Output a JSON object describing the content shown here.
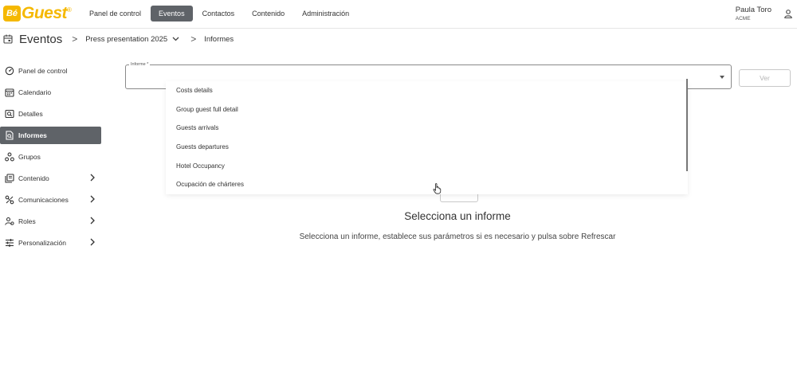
{
  "app": {
    "logo_be": "Bé",
    "logo_guest": "Guest",
    "logo_mark": "®"
  },
  "nav": {
    "items": [
      {
        "label": "Panel de control"
      },
      {
        "label": "Eventos",
        "active": true
      },
      {
        "label": "Contactos"
      },
      {
        "label": "Contenido"
      },
      {
        "label": "Administración"
      }
    ]
  },
  "user": {
    "name": "Paula Toro",
    "org": "ACME",
    "icon": "person-icon"
  },
  "breadcrumb": {
    "icon": "calendar-icon",
    "title": "Eventos",
    "separator": ">",
    "event": "Press presentation 2025",
    "event_chevron": "chevron-down-icon",
    "current": "Informes"
  },
  "sidebar": {
    "items": [
      {
        "label": "Panel de control",
        "icon": "dashboard-icon"
      },
      {
        "label": "Calendario",
        "icon": "calendar-icon"
      },
      {
        "label": "Detalles",
        "icon": "details-icon"
      },
      {
        "label": "Informes",
        "icon": "report-icon",
        "active": true
      },
      {
        "label": "Grupos",
        "icon": "groups-icon"
      },
      {
        "label": "Contenido",
        "icon": "content-icon",
        "expandable": true
      },
      {
        "label": "Comunicaciones",
        "icon": "communications-icon",
        "expandable": true
      },
      {
        "label": "Roles",
        "icon": "roles-icon",
        "expandable": true
      },
      {
        "label": "Personalización",
        "icon": "tune-icon",
        "expandable": true
      }
    ]
  },
  "report_select": {
    "label": "Informe *",
    "value": "",
    "options": [
      "Costs details",
      "Group guest full detail",
      "Guests arrivals",
      "Guests departures",
      "Hotel Occupancy",
      "Ocupación de chárteres"
    ]
  },
  "view_button": {
    "label": "Ver"
  },
  "empty_state": {
    "title": "Selecciona un informe",
    "text": "Selecciona un informe, establece sus parámetros si es necesario y pulsa sobre Refrescar"
  },
  "colors": {
    "accent": "#f5b800",
    "active_bg": "#5f6368"
  }
}
